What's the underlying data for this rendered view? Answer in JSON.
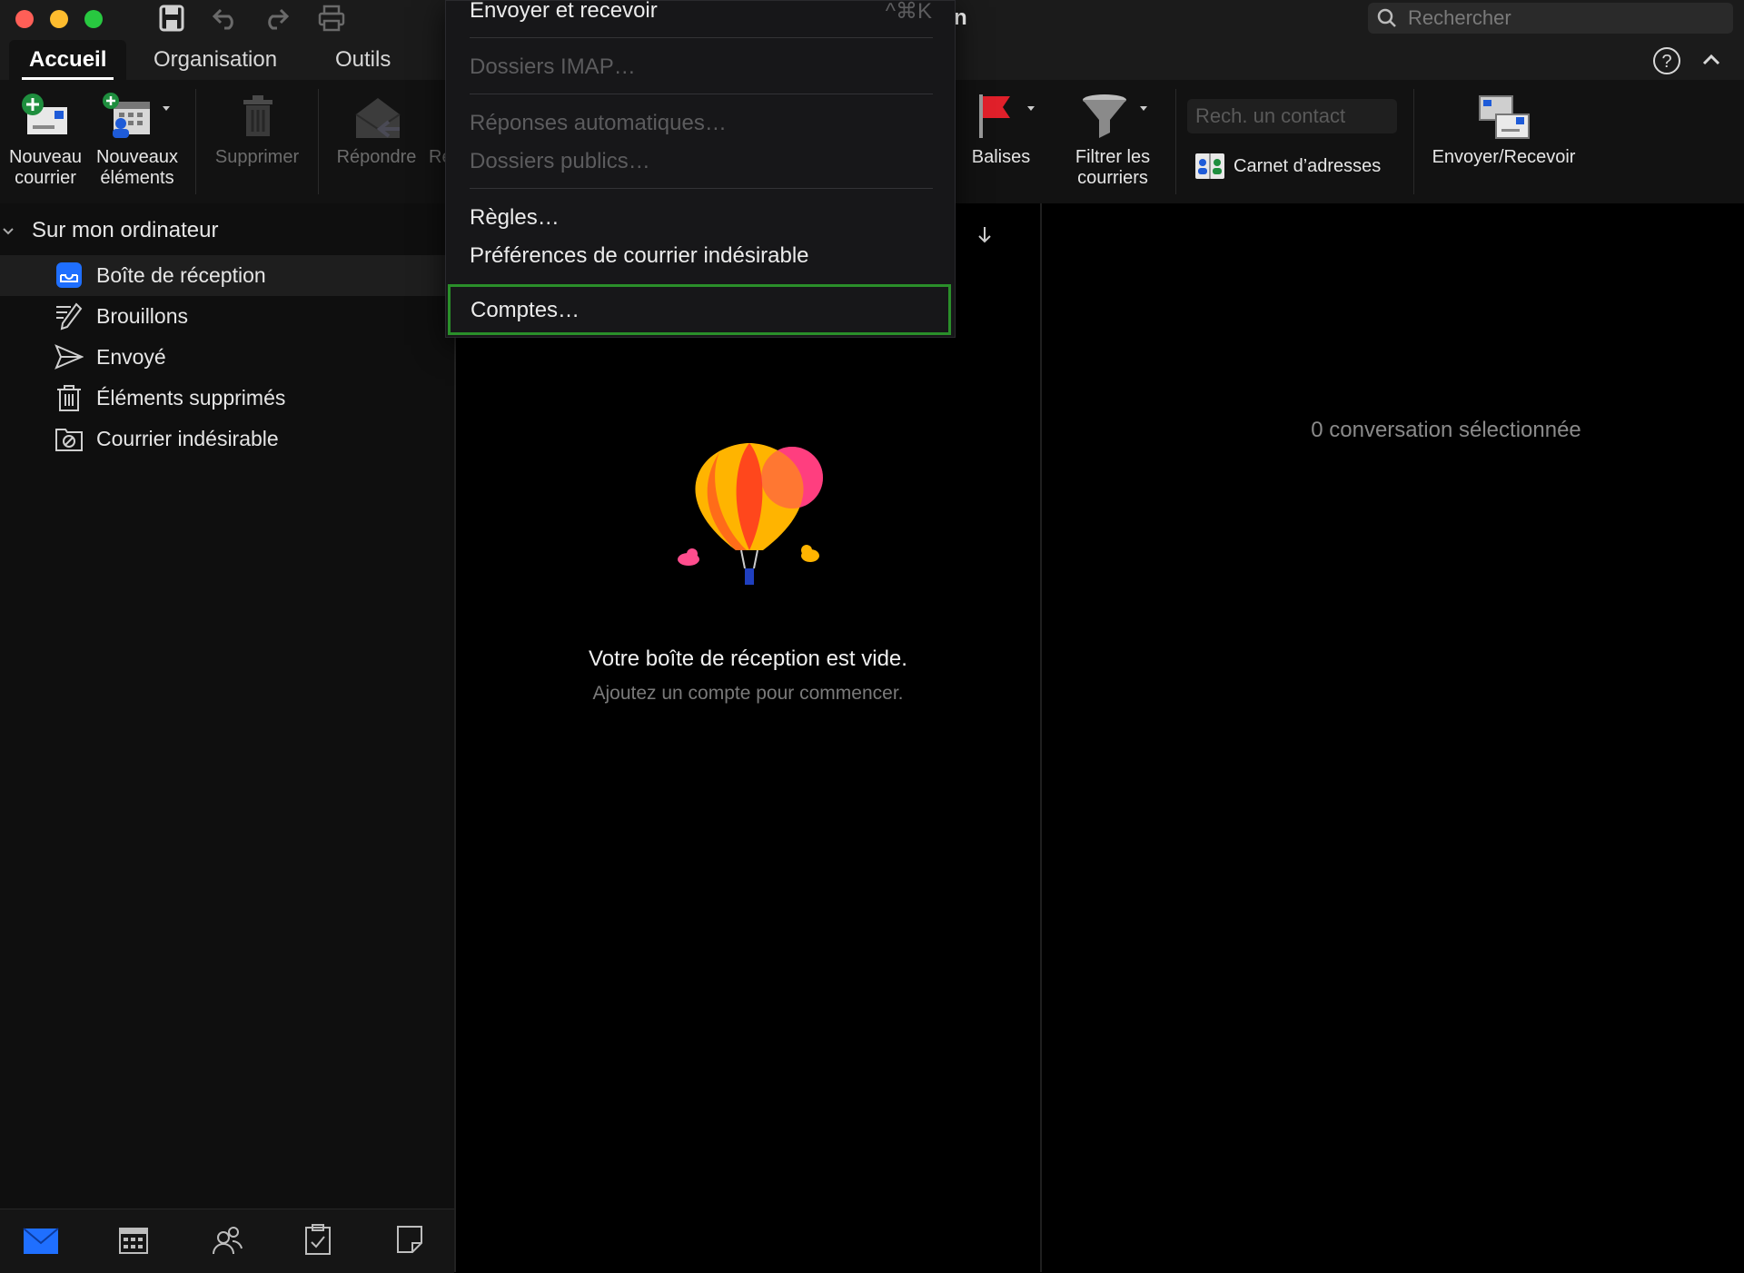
{
  "window": {
    "title_fragment": "n"
  },
  "quick_access": {
    "save_icon": "save-icon",
    "undo_icon": "undo-icon",
    "redo_icon": "redo-icon",
    "print_icon": "print-icon"
  },
  "search": {
    "placeholder": "Rechercher"
  },
  "tabs": [
    {
      "label": "Accueil",
      "active": true
    },
    {
      "label": "Organisation",
      "active": false
    },
    {
      "label": "Outils",
      "active": false
    }
  ],
  "ribbon": {
    "new_mail": {
      "line1": "Nouveau",
      "line2": "courrier"
    },
    "new_items": {
      "line1": "Nouveaux",
      "line2": "éléments"
    },
    "delete": "Supprimer",
    "reply": "Répondre",
    "reply_clip": "Ré",
    "tags": "Balises",
    "filter": {
      "line1": "Filtrer les",
      "line2": "courriers"
    },
    "contact_search_placeholder": "Rech. un contact",
    "address_book": "Carnet d’adresses",
    "send_receive": "Envoyer/Recevoir"
  },
  "sidebar": {
    "group": "Sur mon ordinateur",
    "folders": [
      {
        "label": "Boîte de réception",
        "icon": "inbox-icon",
        "selected": true
      },
      {
        "label": "Brouillons",
        "icon": "drafts-icon",
        "selected": false
      },
      {
        "label": "Envoyé",
        "icon": "sent-icon",
        "selected": false
      },
      {
        "label": "Éléments supprimés",
        "icon": "trash-icon",
        "selected": false
      },
      {
        "label": "Courrier indésirable",
        "icon": "junk-icon",
        "selected": false
      }
    ]
  },
  "bottom_nav": [
    "mail-icon",
    "calendar-icon",
    "people-icon",
    "tasks-icon",
    "notes-icon"
  ],
  "empty_state": {
    "title": "Votre boîte de réception est vide.",
    "subtitle": "Ajoutez un compte pour commencer."
  },
  "reading_pane": {
    "status": "0 conversation sélectionnée"
  },
  "menu": {
    "items": [
      {
        "label": "Envoyer et recevoir",
        "shortcut": "^⌘K",
        "disabled": false
      },
      {
        "label": "Dossiers IMAP…",
        "disabled": true
      },
      {
        "label": "Réponses automatiques…",
        "disabled": true
      },
      {
        "label": "Dossiers publics…",
        "disabled": true
      },
      {
        "label": "Règles…",
        "disabled": false
      },
      {
        "label": "Préférences de courrier indésirable",
        "disabled": false
      },
      {
        "label": "Comptes…",
        "disabled": false,
        "highlighted": true
      }
    ]
  },
  "colors": {
    "accent": "#1f6fff",
    "highlight_border": "#2a8f2a",
    "flag": "#e0202a"
  }
}
